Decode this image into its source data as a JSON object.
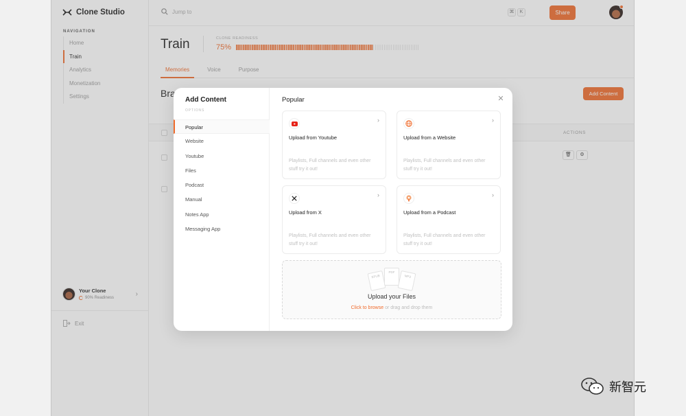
{
  "app": {
    "name": "Clone Studio",
    "accent": "#ef6a2a"
  },
  "sidebar": {
    "heading": "NAVIGATION",
    "items": [
      {
        "label": "Home"
      },
      {
        "label": "Train"
      },
      {
        "label": "Analytics"
      },
      {
        "label": "Monetization"
      },
      {
        "label": "Settings"
      }
    ],
    "active_item": "Train",
    "clone": {
      "name": "Your Clone",
      "readiness": "90% Readiness"
    },
    "exit_label": "Exit"
  },
  "topbar": {
    "search_placeholder": "Jump to",
    "shortcut_keys": [
      "⌘",
      "K"
    ],
    "share_label": "Share"
  },
  "page": {
    "title": "Train",
    "readiness_label": "CLONE READINESS",
    "readiness_value": "75%",
    "readiness_fraction": 0.75,
    "tabs": [
      {
        "label": "Memories"
      },
      {
        "label": "Voice"
      },
      {
        "label": "Purpose"
      }
    ],
    "active_tab": "Memories",
    "section_title": "Bra",
    "add_content_label": "Add Content",
    "table": {
      "actions_header": "ACTIONS"
    }
  },
  "modal": {
    "title": "Add Content",
    "options_label": "OPTIONS",
    "options": [
      {
        "label": "Popular"
      },
      {
        "label": "Website"
      },
      {
        "label": "Youtube"
      },
      {
        "label": "Files"
      },
      {
        "label": "Podcast"
      },
      {
        "label": "Manual"
      },
      {
        "label": "Notes App"
      },
      {
        "label": "Messaging App"
      }
    ],
    "active_option": "Popular",
    "panel_title": "Popular",
    "cards": [
      {
        "title": "Upload from Youtube",
        "desc": "Playlists, Full channels and even other stuff try it out!",
        "icon": "youtube-icon"
      },
      {
        "title": "Upload from a Website",
        "desc": "Playlists, Full channels and even other stuff try it out!",
        "icon": "globe-icon"
      },
      {
        "title": "Upload from X",
        "desc": "Playlists, Full channels and even other stuff try it out!",
        "icon": "x-logo-icon"
      },
      {
        "title": "Upload from a Podcast",
        "desc": "Playlists, Full channels and even other stuff try it out!",
        "icon": "podcast-icon"
      }
    ],
    "upload": {
      "title": "Upload your Files",
      "link": "Click to browse",
      "rest": " or drag and drop them",
      "doc_labels": [
        "EPUB",
        "PDF",
        "MP3"
      ]
    }
  },
  "watermark": {
    "text": "新智元"
  }
}
